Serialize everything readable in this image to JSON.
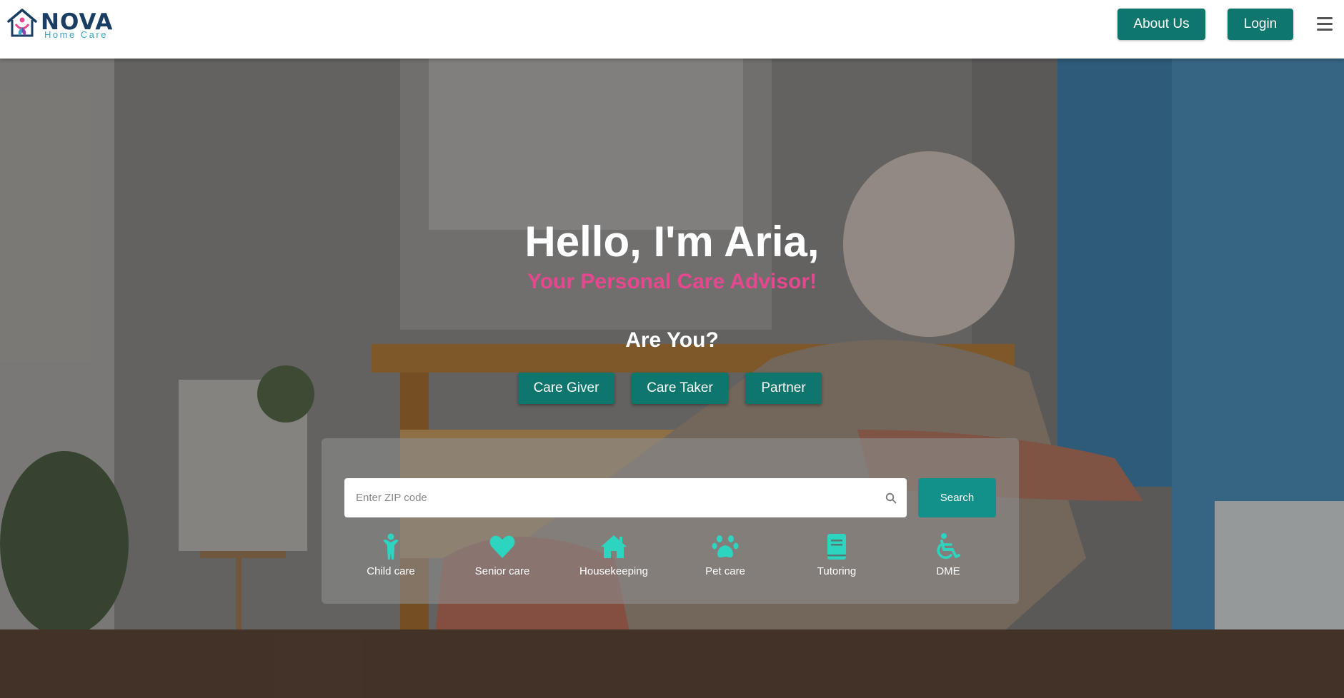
{
  "brand": {
    "name": "NOVA",
    "tagline": "Home Care"
  },
  "header": {
    "about_label": "About Us",
    "login_label": "Login"
  },
  "hero": {
    "title": "Hello, I'm Aria,",
    "subtitle": "Your Personal Care Advisor!",
    "question": "Are You?",
    "roles": [
      "Care Giver",
      "Care Taker",
      "Partner"
    ]
  },
  "search": {
    "placeholder": "Enter ZIP code",
    "button_label": "Search"
  },
  "categories": [
    {
      "label": "Child care",
      "icon": "child-icon"
    },
    {
      "label": "Senior care",
      "icon": "heart-icon"
    },
    {
      "label": "Housekeeping",
      "icon": "house-icon"
    },
    {
      "label": "Pet care",
      "icon": "paw-icon"
    },
    {
      "label": "Tutoring",
      "icon": "book-icon"
    },
    {
      "label": "DME",
      "icon": "wheelchair-icon"
    }
  ],
  "colors": {
    "primary": "#0f766e",
    "accent": "#e6478f",
    "icon": "#2dd4bf",
    "brand_dark": "#1a3d63"
  }
}
